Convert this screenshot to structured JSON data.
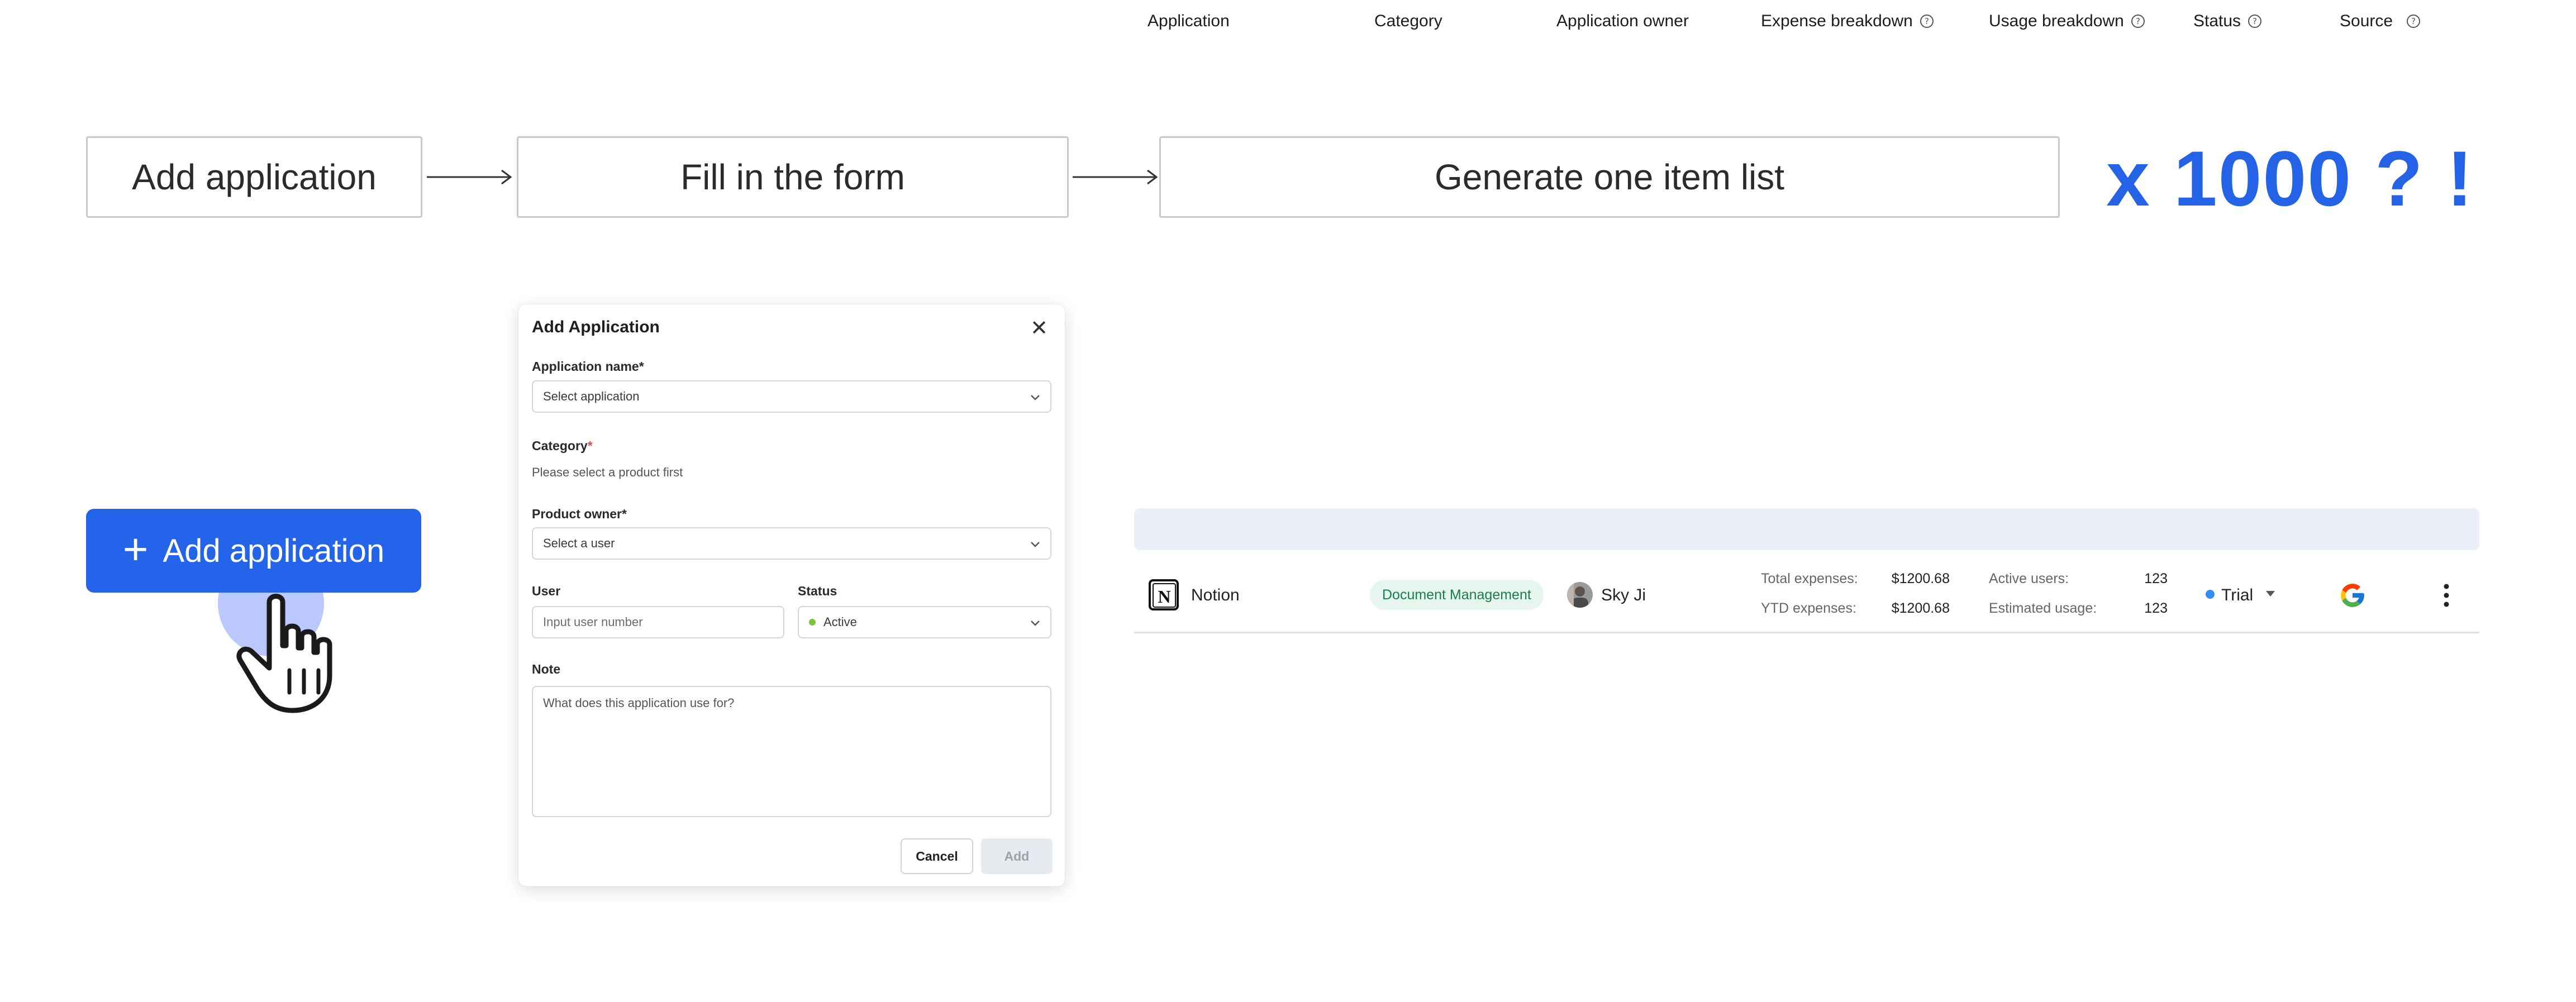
{
  "flow": {
    "step1": "Add application",
    "step2": "Fill in the form",
    "step3": "Generate one item list",
    "repeat": "x 1000 ? !"
  },
  "add_button": {
    "label": "Add application",
    "icon": "plus-icon"
  },
  "modal": {
    "title": "Add Application",
    "app_name_label": "Application name",
    "app_name_placeholder": "Select application",
    "category_label": "Category",
    "category_hint": "Please select a product first",
    "owner_label": "Product owner",
    "owner_placeholder": "Select a user",
    "user_label": "User",
    "user_placeholder": "Input user number",
    "status_label": "Status",
    "status_value": "Active",
    "note_label": "Note",
    "note_placeholder": "What does this application use for?",
    "required_mark": "*",
    "cancel": "Cancel",
    "add": "Add"
  },
  "table": {
    "headers": {
      "application": "Application",
      "category": "Category",
      "owner": "Application owner",
      "expense": "Expense breakdown",
      "usage": "Usage breakdown",
      "status": "Status",
      "source": "Source"
    },
    "row": {
      "app_name": "Notion",
      "category": "Document Management",
      "owner": "Sky Ji",
      "total_expenses_label": "Total expenses:",
      "total_expenses_value": "$1200.68",
      "ytd_expenses_label": "YTD expenses:",
      "ytd_expenses_value": "$1200.68",
      "active_users_label": "Active users:",
      "active_users_value": "123",
      "estimated_usage_label": "Estimated usage:",
      "estimated_usage_value": "123",
      "status": "Trial",
      "source_icon": "google-icon"
    }
  },
  "colors": {
    "accent": "#2464ea",
    "repeat_text": "#2563e6",
    "table_header_bg": "#eaeffa",
    "badge_bg": "#e6f6ee",
    "badge_text": "#1a7d4e",
    "trial_dot": "#2b8ef0",
    "active_dot": "#7bc43a"
  }
}
